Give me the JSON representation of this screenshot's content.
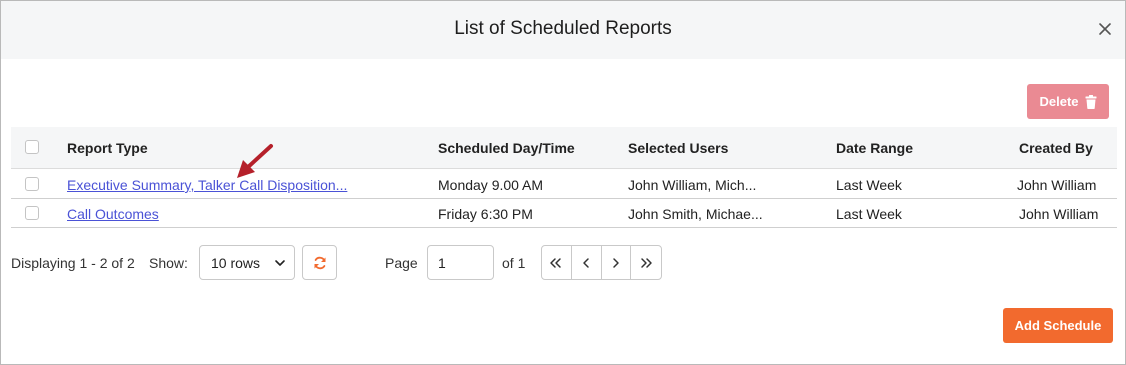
{
  "modal": {
    "title": "List of Scheduled Reports",
    "close_icon": "close-icon"
  },
  "toolbar": {
    "delete_label": "Delete",
    "delete_icon": "trash-icon",
    "delete_color": "#ea8a93"
  },
  "table": {
    "headers": [
      "Report Type",
      "Scheduled Day/Time",
      "Selected Users",
      "Date Range",
      "Created By"
    ],
    "rows": [
      {
        "report_type": "Executive Summary, Talker Call Disposition...",
        "scheduled": "Monday 9.00 AM",
        "users": "John William, Mich...",
        "date_range": "Last Week",
        "created_by": "John William"
      },
      {
        "report_type": "Call Outcomes",
        "scheduled": "Friday 6:30 PM",
        "users": "John Smith, Michae...",
        "date_range": "Last Week",
        "created_by": "John William"
      }
    ],
    "link_color": "#4a52d6"
  },
  "pager": {
    "displaying": "Displaying 1 - 2 of 2",
    "show_label": "Show:",
    "rows_value": "10 rows",
    "page_label": "Page",
    "page_value": "1",
    "of_label": "of 1",
    "nav_icons": [
      "first-page-icon",
      "prev-page-icon",
      "next-page-icon",
      "last-page-icon"
    ]
  },
  "actions": {
    "add_label": "Add Schedule",
    "add_color": "#f26a2e"
  },
  "annotation": {
    "arrow_color": "#b5202a"
  }
}
